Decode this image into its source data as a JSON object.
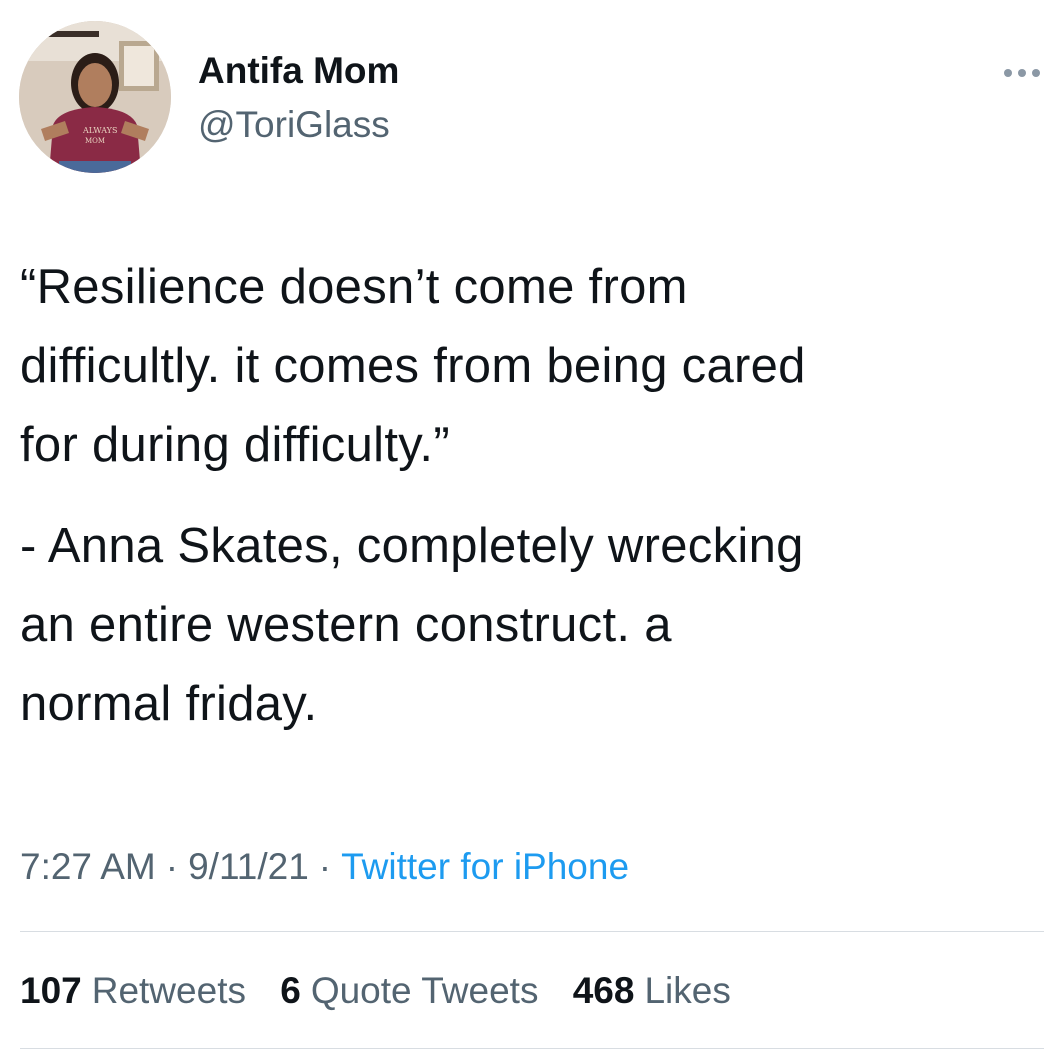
{
  "author": {
    "display_name": "Antifa Mom",
    "handle": "@ToriGlass",
    "avatar_icon": "profile-photo-avatar"
  },
  "menu": {
    "icon": "more-dots-icon"
  },
  "tweet": {
    "paragraphs": [
      "“Resilience doesn’t come from\ndifficultly. it comes from being cared\nfor during difficulty.”",
      "- Anna Skates, completely wrecking\nan entire western construct. a\nnormal friday."
    ]
  },
  "meta": {
    "time": "7:27 AM",
    "separator": "·",
    "date": "9/11/21",
    "source": "Twitter for iPhone"
  },
  "stats": {
    "retweets": {
      "count": "107",
      "label": "Retweets"
    },
    "quotes": {
      "count": "6",
      "label": "Quote Tweets"
    },
    "likes": {
      "count": "468",
      "label": "Likes"
    }
  },
  "colors": {
    "text": "#0f1419",
    "secondary": "#536471",
    "link": "#1d9bf0",
    "divider": "#d8dde2"
  }
}
